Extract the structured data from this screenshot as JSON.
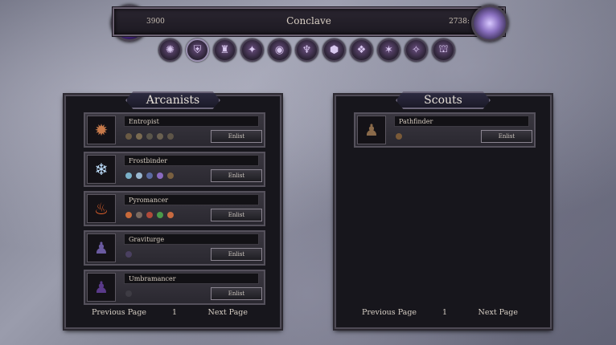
{
  "topbar": {
    "title": "Conclave",
    "resource_left": "3900",
    "resource_right": "2738:"
  },
  "faction_icons": [
    {
      "icon": "beast-faction-icon",
      "glyph": "✺"
    },
    {
      "icon": "helm-faction-icon",
      "glyph": "⛨"
    },
    {
      "icon": "hooded-faction-icon",
      "glyph": "♜"
    },
    {
      "icon": "rune-faction-icon",
      "glyph": "✦"
    },
    {
      "icon": "eye-faction-icon",
      "glyph": "◉"
    },
    {
      "icon": "spire-faction-icon",
      "glyph": "♆"
    },
    {
      "icon": "shield-faction-icon",
      "glyph": "⬢"
    },
    {
      "icon": "scroll-faction-icon",
      "glyph": "❖"
    },
    {
      "icon": "star-faction-icon",
      "glyph": "✶"
    },
    {
      "icon": "compass-faction-icon",
      "glyph": "✧"
    },
    {
      "icon": "gate-faction-icon",
      "glyph": "⛫"
    }
  ],
  "panels": {
    "left": {
      "title": "Arcanists",
      "units": [
        {
          "name": "Entropist",
          "portrait": "✹",
          "portrait_color": "#c87a4a",
          "gems": [
            "#6a5a44",
            "#7a6a50",
            "#5a554a",
            "#6a6050",
            "#5e5548"
          ],
          "enlist": "Enlist"
        },
        {
          "name": "Frostbinder",
          "portrait": "❄",
          "portrait_color": "#bfe0ff",
          "gems": [
            "#7ab0c8",
            "#9ab8d0",
            "#5a6aa0",
            "#8a6ac0",
            "#7a6040"
          ],
          "enlist": "Enlist"
        },
        {
          "name": "Pyromancer",
          "portrait": "♨",
          "portrait_color": "#e0602a",
          "gems": [
            "#c86a3a",
            "#7a6a60",
            "#b04a3a",
            "#4a9a4a",
            "#c86a40"
          ],
          "enlist": "Enlist"
        },
        {
          "name": "Graviturge",
          "portrait": "♟",
          "portrait_color": "#6a5aa0",
          "gems": [
            "#4a4060"
          ],
          "enlist": "Enlist"
        },
        {
          "name": "Umbramancer",
          "portrait": "♟",
          "portrait_color": "#5a3a8a",
          "gems": [
            "#3e3c44"
          ],
          "enlist": "Enlist"
        }
      ],
      "pager": {
        "prev": "Previous Page",
        "page": "1",
        "next": "Next Page"
      }
    },
    "right": {
      "title": "Scouts",
      "units": [
        {
          "name": "Pathfinder",
          "portrait": "♟",
          "portrait_color": "#8a6a4a",
          "gems": [
            "#7a5a38"
          ],
          "enlist": "Enlist"
        }
      ],
      "pager": {
        "prev": "Previous Page",
        "page": "1",
        "next": "Next Page"
      }
    }
  }
}
